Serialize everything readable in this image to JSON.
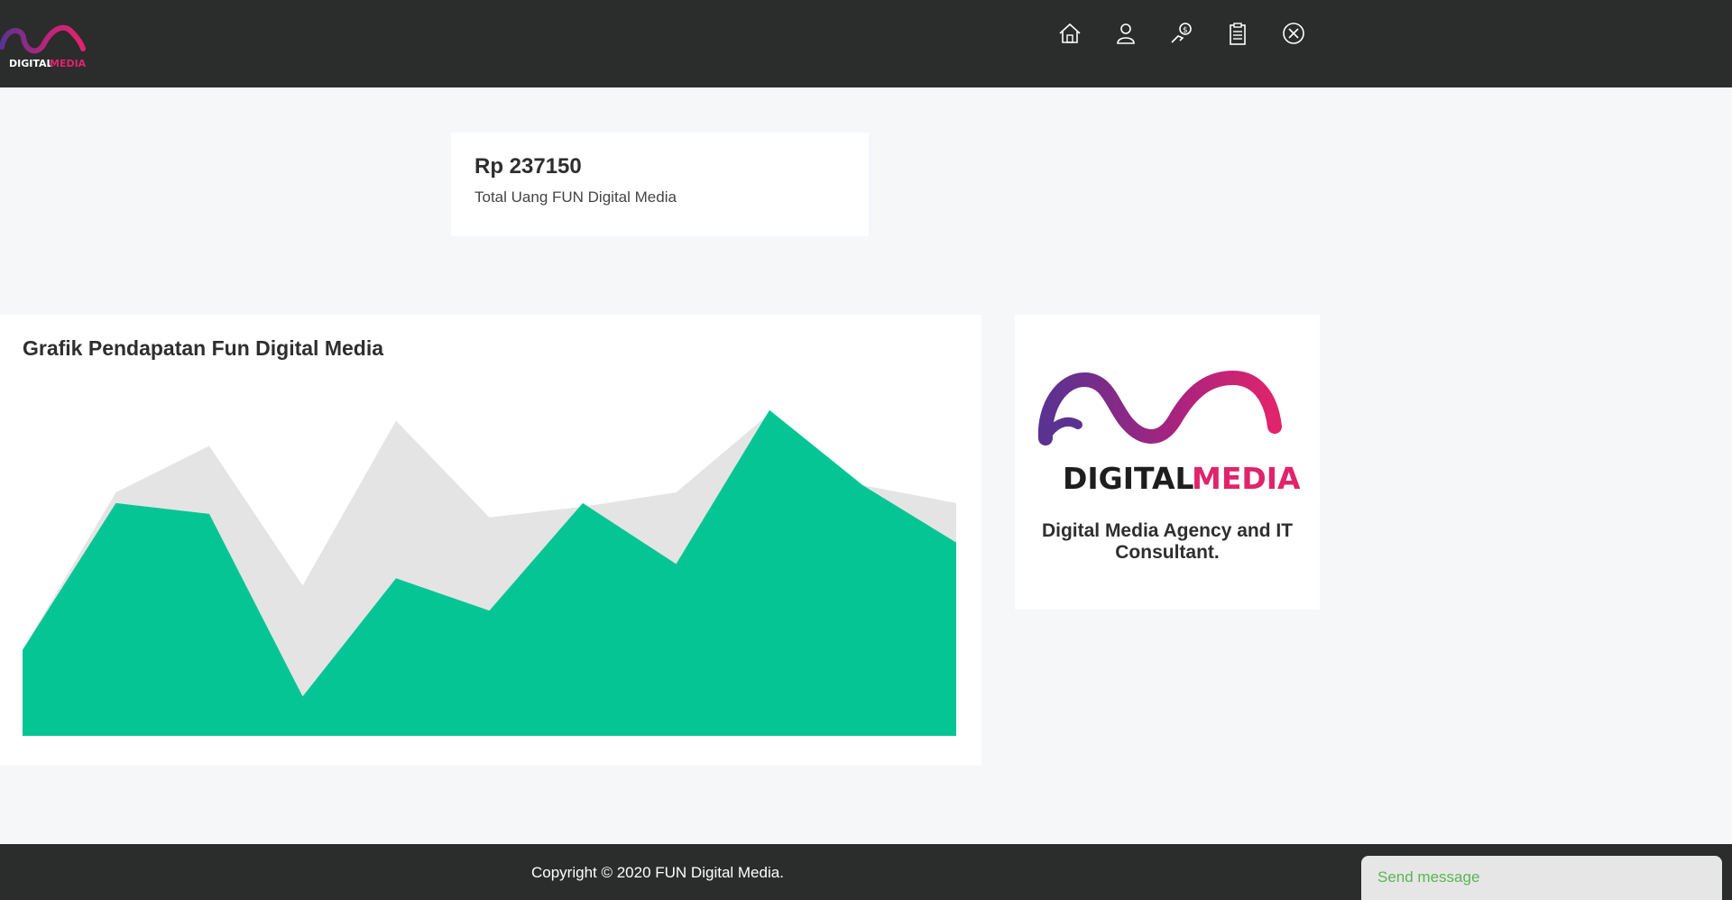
{
  "header": {
    "logo_text": "DIGITAL MEDIA",
    "nav_items": [
      {
        "icon": "home-icon"
      },
      {
        "icon": "user-icon"
      },
      {
        "icon": "money-icon"
      },
      {
        "icon": "clipboard-icon"
      },
      {
        "icon": "close-circle-icon"
      }
    ]
  },
  "stat": {
    "value": "Rp 237150",
    "label": "Total Uang FUN Digital Media"
  },
  "chart": {
    "title": "Grafik Pendapatan Fun Digital Media"
  },
  "chart_data": {
    "type": "area",
    "title": "Grafik Pendapatan Fun Digital Media",
    "xlabel": "",
    "ylabel": "",
    "x": [
      0,
      1,
      2,
      3,
      4,
      5,
      6,
      7,
      8,
      9,
      10
    ],
    "ylim": [
      0,
      100
    ],
    "grid": false,
    "legend": "none",
    "series": [
      {
        "values": [
          24,
          68,
          81,
          42,
          88,
          61,
          64,
          68,
          90,
          70,
          65
        ],
        "color": "#e4e4e4"
      },
      {
        "values": [
          24,
          65,
          62,
          11,
          44,
          35,
          65,
          48,
          91,
          70,
          54
        ],
        "color": "#06c594"
      }
    ]
  },
  "logo_card": {
    "logo_word1": "DIGITAL",
    "logo_word2": "MEDIA",
    "tagline": "Digital Media Agency and IT Consultant."
  },
  "footer": {
    "copyright": "Copyright © 2020 FUN Digital Media."
  },
  "chat": {
    "label": "Send message"
  },
  "colors": {
    "header_bg": "#2b2c2c",
    "brand_pink": "#e0246b",
    "brand_purple": "#5b3290",
    "chart_front": "#06c594",
    "chart_back": "#e4e4e4",
    "chat_text": "#5ab552"
  }
}
